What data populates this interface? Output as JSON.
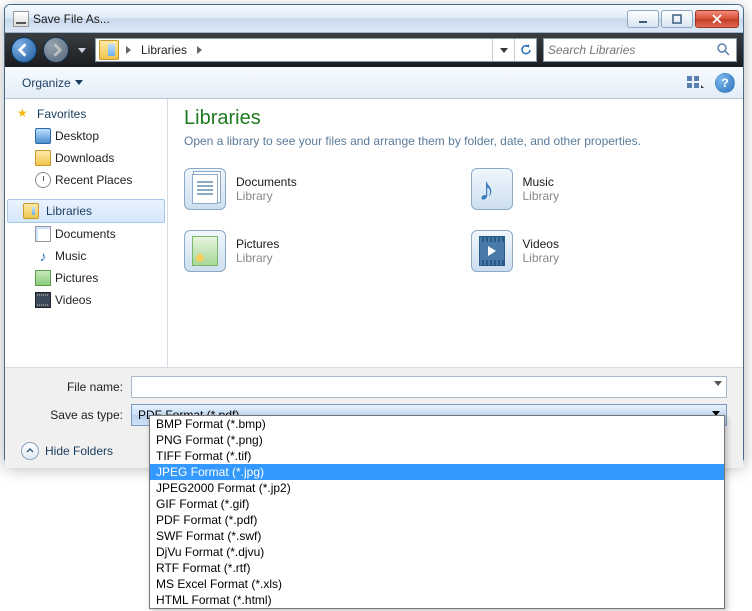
{
  "window": {
    "title": "Save File As..."
  },
  "nav": {
    "location": "Libraries",
    "search_placeholder": "Search Libraries"
  },
  "toolbar": {
    "organize": "Organize"
  },
  "sidebar": {
    "favorites": {
      "label": "Favorites",
      "items": [
        "Desktop",
        "Downloads",
        "Recent Places"
      ]
    },
    "libraries": {
      "label": "Libraries",
      "items": [
        "Documents",
        "Music",
        "Pictures",
        "Videos"
      ]
    }
  },
  "content": {
    "heading": "Libraries",
    "sub": "Open a library to see your files and arrange them by folder, date, and other properties.",
    "type_label": "Library",
    "items": [
      "Documents",
      "Music",
      "Pictures",
      "Videos"
    ]
  },
  "form": {
    "filename_label": "File name:",
    "filename_value": "",
    "saveastype_label": "Save as type:",
    "saveastype_value": "PDF Format (*.pdf)",
    "hide_folders": "Hide Folders"
  },
  "dropdown": {
    "options": [
      "BMP Format (*.bmp)",
      "PNG Format (*.png)",
      "TIFF Format (*.tif)",
      "JPEG Format (*.jpg)",
      "JPEG2000 Format (*.jp2)",
      "GIF Format (*.gif)",
      "PDF Format (*.pdf)",
      "SWF Format (*.swf)",
      "DjVu Format (*.djvu)",
      "RTF Format (*.rtf)",
      "MS Excel Format (*.xls)",
      "HTML Format (*.html)"
    ],
    "highlighted_index": 3
  }
}
